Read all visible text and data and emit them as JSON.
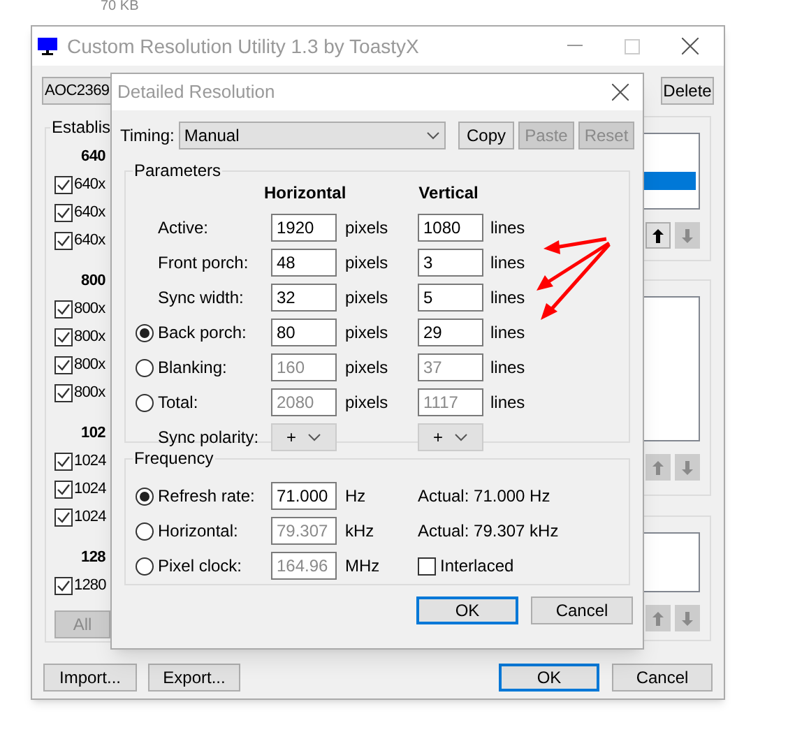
{
  "background_text": "70 KB",
  "main_window": {
    "title": "Custom Resolution Utility 1.3 by ToastyX",
    "device": "AOC2369",
    "delete_button": "Delete",
    "established_group": {
      "title": "Establis",
      "sections": [
        {
          "heading": "640",
          "items": [
            {
              "label": "640x",
              "checked": true
            },
            {
              "label": "640x",
              "checked": true
            },
            {
              "label": "640x",
              "checked": true
            }
          ]
        },
        {
          "heading": "800",
          "items": [
            {
              "label": "800x",
              "checked": true
            },
            {
              "label": "800x",
              "checked": true
            },
            {
              "label": "800x",
              "checked": true
            },
            {
              "label": "800x",
              "checked": true
            }
          ]
        },
        {
          "heading": "102",
          "items": [
            {
              "label": "1024",
              "checked": true
            },
            {
              "label": "1024",
              "checked": true
            },
            {
              "label": "1024",
              "checked": true
            }
          ]
        },
        {
          "heading": "128",
          "items": [
            {
              "label": "1280",
              "checked": true
            }
          ]
        }
      ],
      "all_button": {
        "label": "All",
        "disabled": true
      }
    },
    "lists": [
      {
        "has_selection": true,
        "up_disabled": false,
        "down_disabled": true
      },
      {
        "has_selection": false,
        "up_disabled": true,
        "down_disabled": true
      },
      {
        "has_selection": false,
        "up_disabled": true,
        "down_disabled": true
      }
    ],
    "left_buttons": [
      "Import...",
      "Export..."
    ],
    "right_buttons": [
      {
        "label": "OK",
        "default": true
      },
      {
        "label": "Cancel",
        "default": false
      }
    ]
  },
  "dialog": {
    "title": "Detailed Resolution",
    "timing_label": "Timing:",
    "timing_value": "Manual",
    "timing_buttons": [
      {
        "label": "Copy",
        "disabled": false
      },
      {
        "label": "Paste",
        "disabled": true
      },
      {
        "label": "Reset",
        "disabled": true
      }
    ],
    "parameters": {
      "title": "Parameters",
      "columns": [
        "Horizontal",
        "Vertical"
      ],
      "rows": [
        {
          "kind": "plain",
          "label": "Active:",
          "h_value": "1920",
          "h_unit": "pixels",
          "v_value": "1080",
          "v_unit": "lines",
          "disabled": false
        },
        {
          "kind": "plain",
          "label": "Front porch:",
          "h_value": "48",
          "h_unit": "pixels",
          "v_value": "3",
          "v_unit": "lines",
          "disabled": false
        },
        {
          "kind": "plain",
          "label": "Sync width:",
          "h_value": "32",
          "h_unit": "pixels",
          "v_value": "5",
          "v_unit": "lines",
          "disabled": false
        },
        {
          "kind": "radio",
          "label": "Back porch:",
          "selected": true,
          "h_value": "80",
          "h_unit": "pixels",
          "v_value": "29",
          "v_unit": "lines",
          "disabled": false
        },
        {
          "kind": "radio",
          "label": "Blanking:",
          "selected": false,
          "h_value": "160",
          "h_unit": "pixels",
          "v_value": "37",
          "v_unit": "lines",
          "disabled": true
        },
        {
          "kind": "radio",
          "label": "Total:",
          "selected": false,
          "h_value": "2080",
          "h_unit": "pixels",
          "v_value": "1117",
          "v_unit": "lines",
          "disabled": true
        },
        {
          "kind": "select",
          "label": "Sync polarity:",
          "h_value": "+",
          "v_value": "+"
        }
      ]
    },
    "frequency": {
      "title": "Frequency",
      "rows": [
        {
          "label": "Refresh rate:",
          "selected": true,
          "value": "71.000",
          "unit": "Hz",
          "disabled": false,
          "note": "Actual: 71.000 Hz"
        },
        {
          "label": "Horizontal:",
          "selected": false,
          "value": "79.307",
          "unit": "kHz",
          "disabled": true,
          "note": "Actual: 79.307 kHz"
        },
        {
          "label": "Pixel clock:",
          "selected": false,
          "value": "164.96",
          "unit": "MHz",
          "disabled": true,
          "checkbox": {
            "label": "Interlaced",
            "checked": false
          }
        }
      ]
    },
    "buttons": [
      {
        "label": "OK",
        "default": true
      },
      {
        "label": "Cancel",
        "default": false
      }
    ]
  }
}
